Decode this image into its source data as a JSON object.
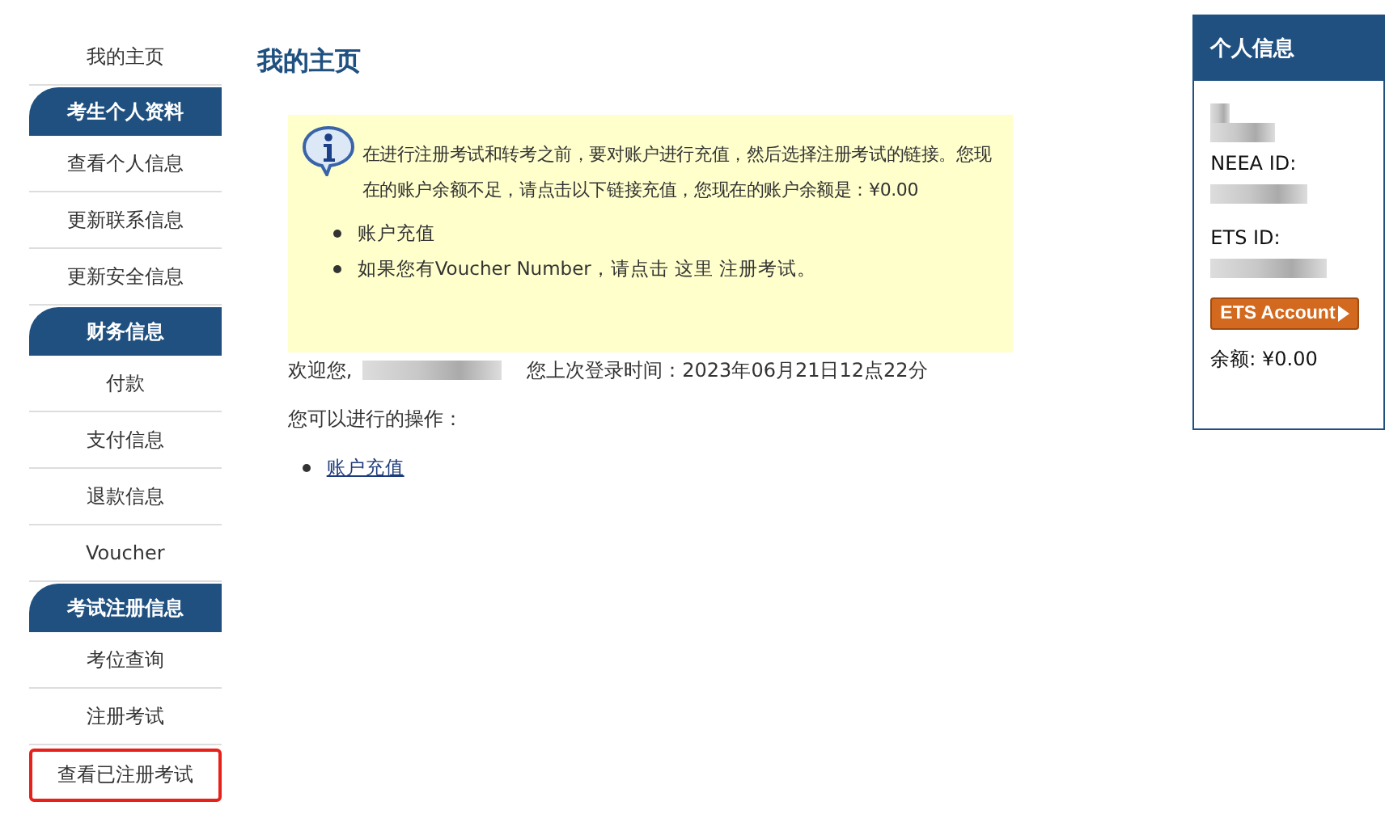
{
  "sidebar": {
    "items": [
      {
        "kind": "link",
        "label": "我的主页",
        "highlighted": false
      },
      {
        "kind": "header",
        "label": "考生个人资料"
      },
      {
        "kind": "link",
        "label": "查看个人信息",
        "highlighted": false
      },
      {
        "kind": "link",
        "label": "更新联系信息",
        "highlighted": false
      },
      {
        "kind": "link",
        "label": "更新安全信息",
        "highlighted": false
      },
      {
        "kind": "header",
        "label": "财务信息"
      },
      {
        "kind": "link",
        "label": "付款",
        "highlighted": false
      },
      {
        "kind": "link",
        "label": "支付信息",
        "highlighted": false
      },
      {
        "kind": "link",
        "label": "退款信息",
        "highlighted": false
      },
      {
        "kind": "link",
        "label": "Voucher",
        "highlighted": false
      },
      {
        "kind": "header",
        "label": "考试注册信息"
      },
      {
        "kind": "link",
        "label": "考位查询",
        "highlighted": false
      },
      {
        "kind": "link",
        "label": "注册考试",
        "highlighted": false
      },
      {
        "kind": "link",
        "label": "查看已注册考试",
        "highlighted": true
      }
    ]
  },
  "main": {
    "title": "我的主页",
    "notice": {
      "message": "在进行注册考试和转考之前，要对账户进行充值，然后选择注册考试的链接。您现在的账户余额不足，请点击以下链接充值，您现在的账户余额是：¥0.00",
      "bullets": [
        "账户充值",
        "如果您有Voucher Number，请点击 这里 注册考试。"
      ]
    },
    "welcome": "欢迎您,",
    "last_login": "您上次登录时间：2023年06月21日12点22分",
    "actions_label": "您可以进行的操作：",
    "actions": [
      "账户充值"
    ]
  },
  "profile": {
    "title": "个人信息",
    "neea_label": "NEEA ID:",
    "ets_label": "ETS ID:",
    "button": "ETS Account",
    "balance": "余额: ¥0.00"
  }
}
